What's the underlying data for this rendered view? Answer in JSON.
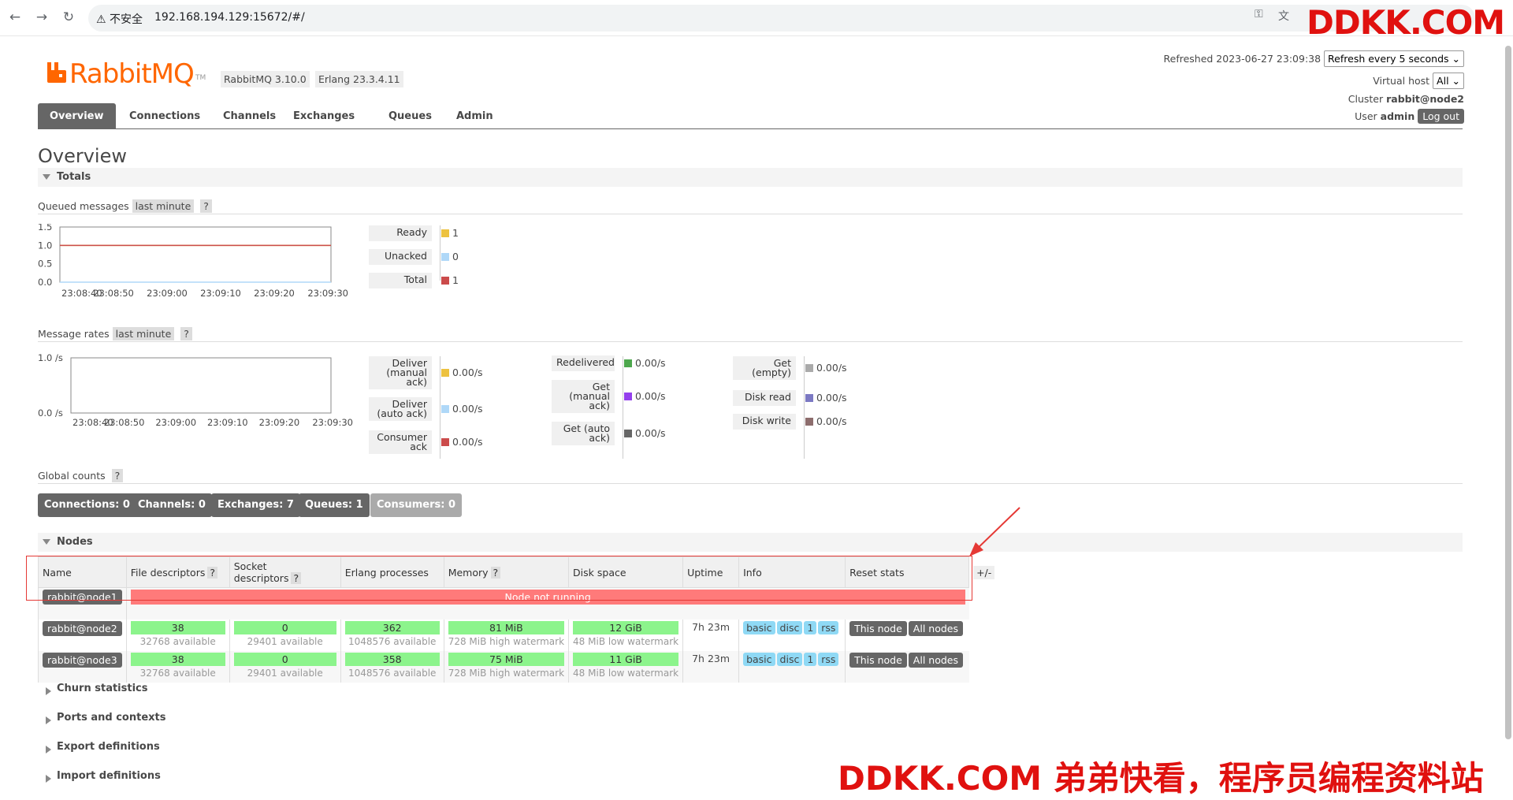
{
  "browser": {
    "insecure_label": "不安全",
    "url": "192.168.194.129:15672/#/"
  },
  "app": {
    "logo_text": "RabbitMQ",
    "logo_tm": "TM",
    "version": "RabbitMQ 3.10.0",
    "erlang": "Erlang 23.3.4.11",
    "tabs": [
      "Overview",
      "Connections",
      "Channels",
      "Exchanges",
      "Queues",
      "Admin"
    ],
    "active_tab": "Overview"
  },
  "header_right": {
    "refreshed": "Refreshed 2023-06-27 23:09:38",
    "refresh_select": "Refresh every 5 seconds",
    "virtual_host_label": "Virtual host",
    "virtual_host_value": "All",
    "cluster_label": "Cluster",
    "cluster_value": "rabbit@node2",
    "user_label": "User",
    "user_value": "admin",
    "logout": "Log out"
  },
  "page_title": "Overview",
  "totals": {
    "title": "Totals",
    "queued_label": "Queued messages",
    "queued_range": "last minute",
    "help": "?",
    "queued_chart_ticks_y": [
      "1.5",
      "1.0",
      "0.5",
      "0.0"
    ],
    "queued_chart_ticks_x": [
      "23:08:40",
      "23:08:50",
      "23:09:00",
      "23:09:10",
      "23:09:20",
      "23:09:30"
    ],
    "queued_legend": [
      {
        "label": "Ready",
        "value": "1",
        "color": "#edc240"
      },
      {
        "label": "Unacked",
        "value": "0",
        "color": "#afd8f8"
      },
      {
        "label": "Total",
        "value": "1",
        "color": "#cb4b4b"
      }
    ],
    "rates_label": "Message rates",
    "rates_range": "last minute",
    "rates_chart_ticks_y": [
      "1.0 /s",
      "0.0 /s"
    ],
    "rates_col1": [
      {
        "label": "Deliver (manual ack)",
        "lines": [
          "Deliver",
          "(manual",
          "ack)"
        ],
        "value": "0.00/s",
        "color": "#edc240"
      },
      {
        "label": "Deliver (auto ack)",
        "lines": [
          "Deliver",
          "(auto ack)"
        ],
        "value": "0.00/s",
        "color": "#afd8f8"
      },
      {
        "label": "Consumer ack",
        "lines": [
          "Consumer",
          "ack"
        ],
        "value": "0.00/s",
        "color": "#cb4b4b"
      }
    ],
    "rates_col2": [
      {
        "label": "Redelivered",
        "lines": [
          "Redelivered"
        ],
        "value": "0.00/s",
        "color": "#4da74d"
      },
      {
        "label": "Get (manual ack)",
        "lines": [
          "Get",
          "(manual",
          "ack)"
        ],
        "value": "0.00/s",
        "color": "#9440ed"
      },
      {
        "label": "Get (auto ack)",
        "lines": [
          "Get (auto",
          "ack)"
        ],
        "value": "0.00/s",
        "color": "#666666"
      }
    ],
    "rates_col3": [
      {
        "label": "Get (empty)",
        "lines": [
          "Get",
          "(empty)"
        ],
        "value": "0.00/s",
        "color": "#aaaaaa"
      },
      {
        "label": "Disk read",
        "lines": [
          "Disk read"
        ],
        "value": "0.00/s",
        "color": "#7c79c3"
      },
      {
        "label": "Disk write",
        "lines": [
          "Disk write"
        ],
        "value": "0.00/s",
        "color": "#8d6d6d"
      }
    ],
    "global_label": "Global counts",
    "global_counts": [
      {
        "label": "Connections: 0"
      },
      {
        "label": "Channels: 0"
      },
      {
        "label": "Exchanges: 7"
      },
      {
        "label": "Queues: 1"
      },
      {
        "label": "Consumers: 0"
      }
    ]
  },
  "chart_data": [
    {
      "type": "line",
      "title": "Queued messages",
      "x": [
        "23:08:40",
        "23:08:50",
        "23:09:00",
        "23:09:10",
        "23:09:20",
        "23:09:30"
      ],
      "ylim": [
        0,
        1.5
      ],
      "series": [
        {
          "name": "Ready",
          "values": [
            1,
            1,
            1,
            1,
            1,
            1
          ]
        },
        {
          "name": "Unacked",
          "values": [
            0,
            0,
            0,
            0,
            0,
            0
          ]
        },
        {
          "name": "Total",
          "values": [
            1,
            1,
            1,
            1,
            1,
            1
          ]
        }
      ]
    },
    {
      "type": "line",
      "title": "Message rates",
      "x": [
        "23:08:40",
        "23:08:50",
        "23:09:00",
        "23:09:10",
        "23:09:20",
        "23:09:30"
      ],
      "ylim": [
        0,
        1.0
      ],
      "series": []
    }
  ],
  "nodes": {
    "title": "Nodes",
    "headers": [
      "Name",
      "File descriptors",
      "Socket descriptors",
      "Erlang processes",
      "Memory",
      "Disk space",
      "Uptime",
      "Info",
      "Reset stats",
      "+/-"
    ],
    "help": "?",
    "rows": [
      {
        "name": "rabbit@node1",
        "not_running": "Node not running"
      },
      {
        "name": "rabbit@node2",
        "fd": "38",
        "fd_sub": "32768 available",
        "sd": "0",
        "sd_sub": "29401 available",
        "ep": "362",
        "ep_sub": "1048576 available",
        "mem": "81 MiB",
        "mem_sub": "728 MiB high watermark",
        "disk": "12 GiB",
        "disk_sub": "48 MiB low watermark",
        "uptime": "7h 23m",
        "info": [
          "basic",
          "disc",
          "1",
          "rss"
        ],
        "btn_this": "This node",
        "btn_all": "All nodes"
      },
      {
        "name": "rabbit@node3",
        "fd": "38",
        "fd_sub": "32768 available",
        "sd": "0",
        "sd_sub": "29401 available",
        "ep": "358",
        "ep_sub": "1048576 available",
        "mem": "75 MiB",
        "mem_sub": "728 MiB high watermark",
        "disk": "11 GiB",
        "disk_sub": "48 MiB low watermark",
        "uptime": "7h 23m",
        "info": [
          "basic",
          "disc",
          "1",
          "rss"
        ],
        "btn_this": "This node",
        "btn_all": "All nodes"
      }
    ]
  },
  "collapsed_sections": [
    "Churn statistics",
    "Ports and contexts",
    "Export definitions",
    "Import definitions"
  ],
  "watermarks": {
    "top": "DDKK.COM",
    "bottom": "DDKK.COM 弟弟快看，程序员编程资料站"
  }
}
